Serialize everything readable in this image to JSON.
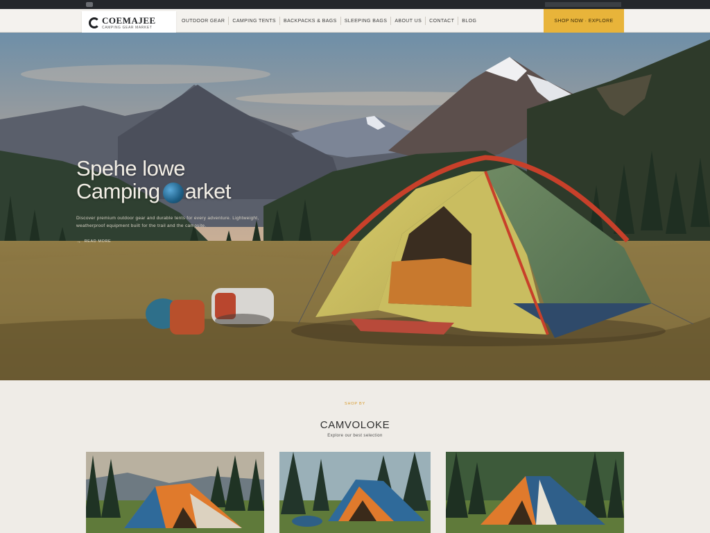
{
  "brand": {
    "name": "COEMAJEE",
    "tagline": "CAMPING GEAR MARKET"
  },
  "nav": {
    "links": [
      {
        "label": "OUTDOOR GEAR"
      },
      {
        "label": "CAMPING TENTS"
      },
      {
        "label": "BACKPACKS & BAGS"
      },
      {
        "label": "SLEEPING BAGS"
      },
      {
        "label": "ABOUT US"
      },
      {
        "label": "CONTACT"
      },
      {
        "label": "BLOG"
      }
    ],
    "cta_label": "SHOP NOW · EXPLORE"
  },
  "hero": {
    "line1": "Spehe lowe",
    "line2_start": "Camping",
    "line2_end": "arket",
    "description": "Discover premium outdoor gear and durable tents for every adventure. Lightweight, weatherproof equipment built for the trail and the campsite.",
    "link_label": "READ MORE"
  },
  "section": {
    "kicker": "SHOP BY",
    "title": "CAMVOLOKE",
    "subtitle": "Explore our best selection"
  },
  "cards": [
    {
      "name": "tent-card-1"
    },
    {
      "name": "tent-card-2"
    },
    {
      "name": "tent-card-3"
    }
  ],
  "colors": {
    "accent": "#e8b43a",
    "topbar": "#24272b",
    "section_bg": "#efece7",
    "kicker": "#d79a2b"
  }
}
